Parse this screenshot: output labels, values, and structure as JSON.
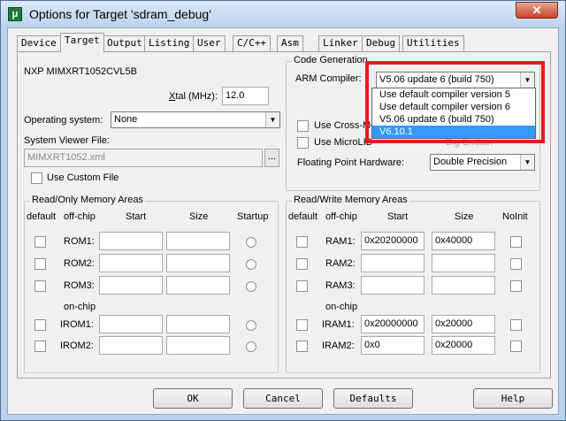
{
  "window": {
    "title": "Options for Target 'sdram_debug'",
    "close_label": "✕"
  },
  "tabs": [
    {
      "label": "Device"
    },
    {
      "label": "Target"
    },
    {
      "label": "Output"
    },
    {
      "label": "Listing"
    },
    {
      "label": "User"
    },
    {
      "label": "C/C++"
    },
    {
      "label": "Asm"
    },
    {
      "label": "Linker"
    },
    {
      "label": "Debug"
    },
    {
      "label": "Utilities"
    }
  ],
  "target": {
    "device_name": "NXP MIMXRT1052CVL5B",
    "xtal_label_pre": "X",
    "xtal_label_post": "tal (MHz):",
    "xtal_value": "12.0",
    "os_label": "Operating system:",
    "os_value": "None",
    "svf_label": "System Viewer File:",
    "svf_value": "MIMXRT1052.xml",
    "svf_browse": "...",
    "custom_file_label": "Use Custom File"
  },
  "codegen": {
    "group_title": "Code Generation",
    "compiler_label": "ARM Compiler:",
    "compiler_value": "V5.06 update 6 (build 750)",
    "cross_module_label": "Use Cross-Mo",
    "microlib_label": "Use MicroLIB",
    "big_endian_label": "Big Endian",
    "fph_label": "Floating Point Hardware:",
    "fph_value": "Double Precision",
    "dropdown_options": [
      {
        "label": "Use default compiler version 5"
      },
      {
        "label": "Use default compiler version 6"
      },
      {
        "label": "V5.06 update 6 (build 750)"
      },
      {
        "label": "V6.10.1"
      }
    ],
    "highlight_color": "#e51c1c"
  },
  "ro_memory": {
    "group_title": "Read/Only Memory Areas",
    "headers": {
      "default": "default",
      "offchip": "off-chip",
      "start": "Start",
      "size": "Size",
      "startup": "Startup"
    },
    "onchip_label": "on-chip",
    "rows": [
      {
        "label": "ROM1:",
        "start": "",
        "size": ""
      },
      {
        "label": "ROM2:",
        "start": "",
        "size": ""
      },
      {
        "label": "ROM3:",
        "start": "",
        "size": ""
      },
      {
        "label": "IROM1:",
        "start": "",
        "size": ""
      },
      {
        "label": "IROM2:",
        "start": "",
        "size": ""
      }
    ]
  },
  "rw_memory": {
    "group_title": "Read/Write Memory Areas",
    "headers": {
      "default": "default",
      "offchip": "off-chip",
      "start": "Start",
      "size": "Size",
      "noinit": "NoInit"
    },
    "onchip_label": "on-chip",
    "rows": [
      {
        "label": "RAM1:",
        "start": "0x20200000",
        "size": "0x40000"
      },
      {
        "label": "RAM2:",
        "start": "",
        "size": ""
      },
      {
        "label": "RAM3:",
        "start": "",
        "size": ""
      },
      {
        "label": "IRAM1:",
        "start": "0x20000000",
        "size": "0x20000"
      },
      {
        "label": "IRAM2:",
        "start": "0x0",
        "size": "0x20000"
      }
    ]
  },
  "buttons": {
    "ok": "OK",
    "cancel": "Cancel",
    "defaults": "Defaults",
    "help": "Help"
  }
}
